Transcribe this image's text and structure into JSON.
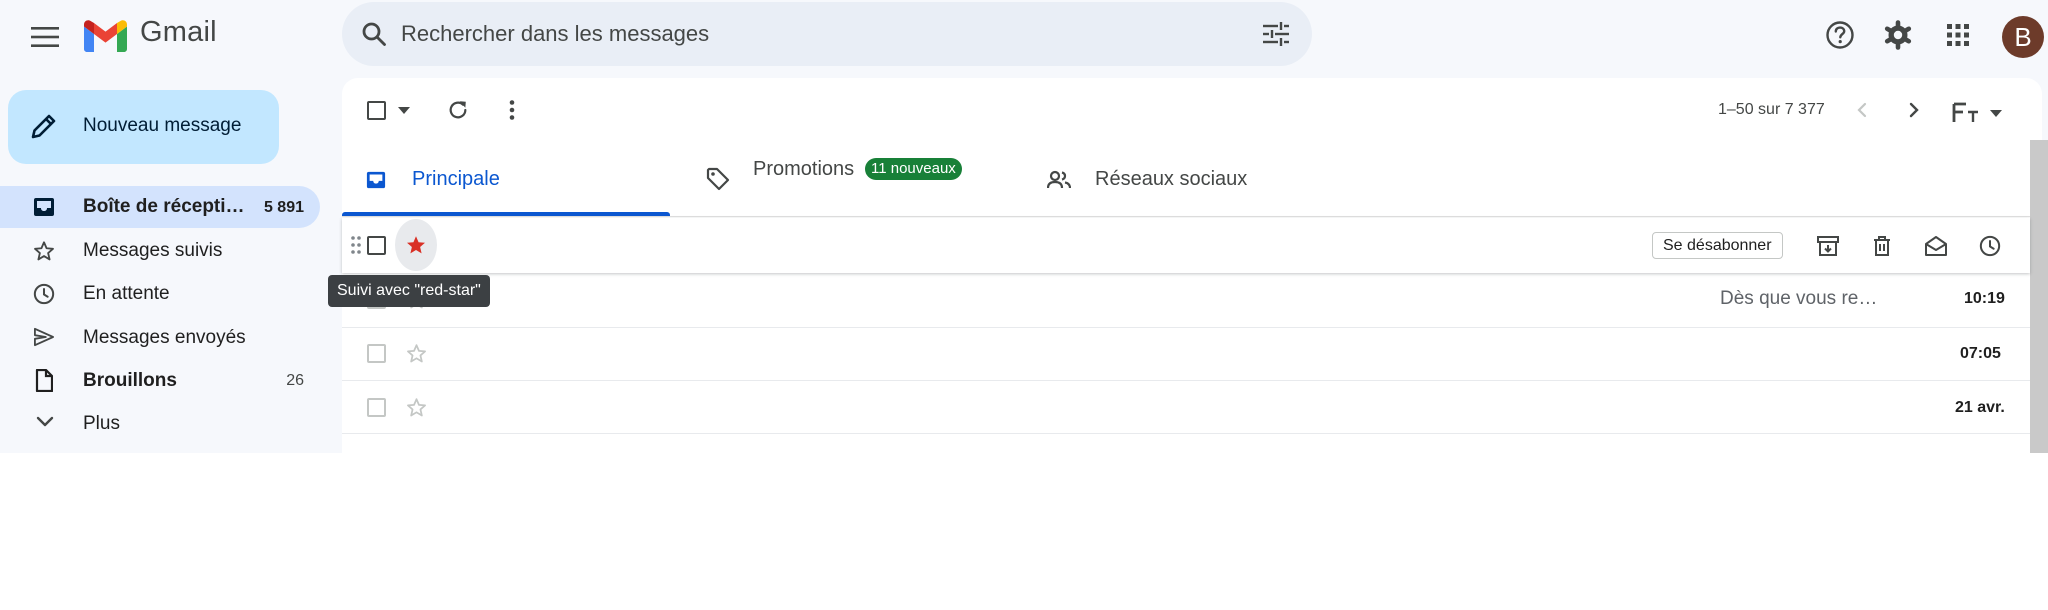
{
  "app": {
    "brand": "Gmail"
  },
  "search": {
    "placeholder": "Rechercher dans les messages"
  },
  "account": {
    "initial": "B"
  },
  "compose": {
    "label": "Nouveau message"
  },
  "sidebar": {
    "items": [
      {
        "label": "Boîte de récepti…",
        "count": "5 891",
        "bold": true,
        "active": true,
        "icon": "inbox-icon"
      },
      {
        "label": "Messages suivis",
        "count": "",
        "icon": "star-icon"
      },
      {
        "label": "En attente",
        "count": "",
        "icon": "clock-icon"
      },
      {
        "label": "Messages envoyés",
        "count": "",
        "icon": "send-icon"
      },
      {
        "label": "Brouillons",
        "count": "26",
        "bold": true,
        "icon": "draft-icon"
      },
      {
        "label": "Plus",
        "count": "",
        "icon": "chevron-down-icon"
      }
    ]
  },
  "toolbar": {
    "pagination": "1–50 sur 7 377"
  },
  "tabs": [
    {
      "label": "Principale",
      "icon": "inbox-icon",
      "active": true
    },
    {
      "label": "Promotions",
      "icon": "tag-icon",
      "badge": "11 nouveaux"
    },
    {
      "label": "Réseaux sociaux",
      "icon": "people-icon"
    }
  ],
  "hover_row": {
    "unsubscribe_label": "Se désabonner",
    "tooltip": "Suivi avec \"red-star\"",
    "actions": [
      "archive-icon",
      "delete-icon",
      "mark-read-icon",
      "snooze-icon"
    ]
  },
  "rows": [
    {
      "snippet": "Dès que vous re…",
      "time": "10:19"
    },
    {
      "snippet": "",
      "time": "07:05"
    },
    {
      "snippet": "",
      "time": "21 avr."
    }
  ],
  "colors": {
    "accent": "#0b57d0",
    "compose_bg": "#c2e7ff",
    "active_nav_bg": "#d3e3fd",
    "badge_bg": "#188038",
    "red_star": "#d93025",
    "app_bg": "#f6f8fc"
  }
}
